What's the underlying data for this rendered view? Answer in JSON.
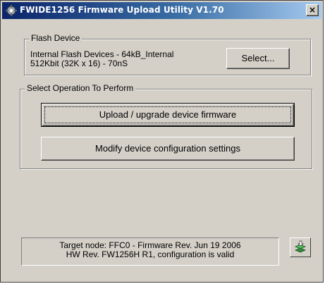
{
  "window": {
    "title": "FWIDE1256 Firmware Upload Utility V1.70",
    "close_label": "×"
  },
  "flash_device": {
    "legend": "Flash Device",
    "line1": "Internal Flash Devices - 64kB_Internal",
    "line2": "512Kbit (32K x 16) - 70nS",
    "select_label": "Select..."
  },
  "operation": {
    "legend": "Select Operation To Perform",
    "upload_label": "Upload / upgrade device firmware",
    "modify_label": "Modify device configuration settings"
  },
  "status": {
    "line1": "Target node: FFC0 - Firmware Rev. Jun 19 2006",
    "line2": "HW Rev. FW1256H R1, configuration is valid",
    "icon": "connection-icon"
  },
  "colors": {
    "title_start": "#0a246a",
    "title_end": "#a6caf0",
    "face": "#d4d0c8"
  }
}
